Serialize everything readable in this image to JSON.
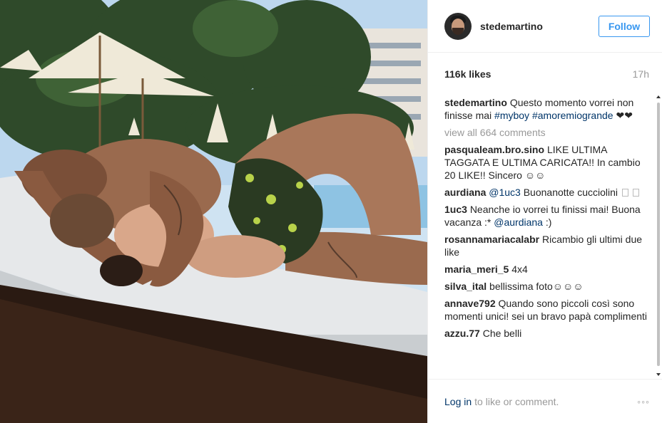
{
  "post": {
    "username": "stedemartino",
    "follow_label": "Follow",
    "likes": "116k likes",
    "time": "17h",
    "caption": {
      "user": "stedemartino",
      "text": "Questo momento vorrei non finisse mai",
      "tag1": "#myboy",
      "tag2": "#amoremiogrande",
      "hearts": "❤❤"
    },
    "view_all": "view all 664 comments",
    "comments": [
      {
        "user": "pasqualeam.bro.sino",
        "text": "LIKE ULTIMA TAGGATA E ULTIMA CARICATA!! In cambio 20 LIKE!! Sincero ☺☺"
      },
      {
        "user": "aurdiana",
        "mention": "@1uc3",
        "text": "Buonanotte cucciolini"
      },
      {
        "user": "1uc3",
        "text": "Neanche io vorrei tu finissi mai! Buona vacanza :*",
        "mention": "@aurdiana",
        "tail": ":)"
      },
      {
        "user": "rosannamariacalabr",
        "text": "Ricambio gli ultimi due like"
      },
      {
        "user": "maria_meri_5",
        "text": "4x4"
      },
      {
        "user": "silva_ital",
        "text": "bellissima foto☺☺☺"
      },
      {
        "user": "annave792",
        "text": "Quando sono piccoli così sono momenti unici! sei un bravo papà complimenti"
      },
      {
        "user": "azzu.77",
        "text": "Che belli"
      }
    ],
    "footer": {
      "login": "Log in",
      "rest": "to like or comment.",
      "more": "◦◦◦"
    }
  },
  "icons": {
    "avatar": "profile-avatar",
    "more": "more-options-icon"
  }
}
